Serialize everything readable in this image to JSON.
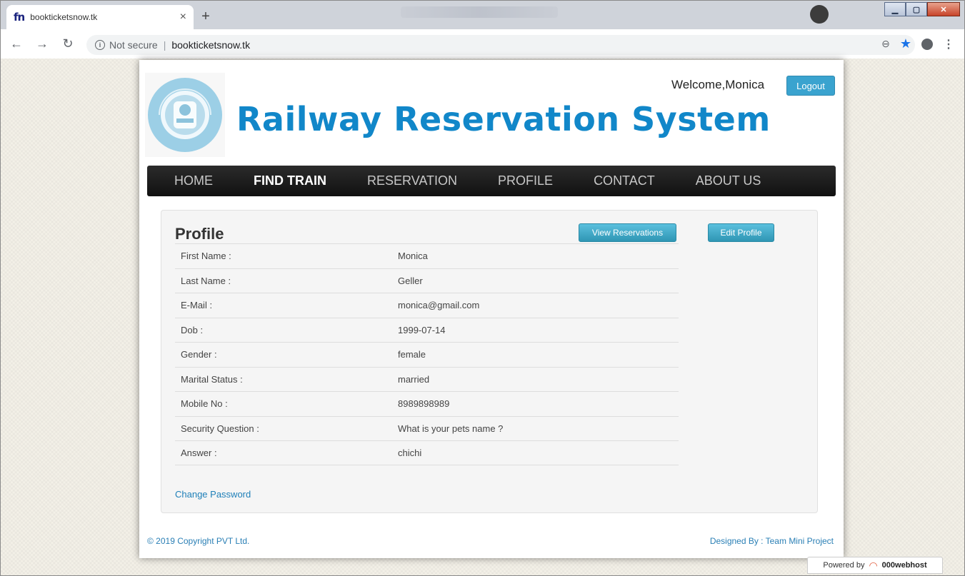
{
  "browser": {
    "tab_title": "bookticketsnow.tk",
    "favicon_text": "fn",
    "close_glyph": "×",
    "new_tab_glyph": "+",
    "not_secure_label": "Not secure",
    "url": "bookticketsnow.tk"
  },
  "header": {
    "site_title": "Railway Reservation System",
    "welcome_text": "Welcome,Monica",
    "logout_label": "Logout",
    "logo_text": "INDIAN RAILWAYS",
    "brand_color": "#1187c9"
  },
  "nav": {
    "items": [
      {
        "label": "HOME",
        "active": false
      },
      {
        "label": "FIND TRAIN",
        "active": true
      },
      {
        "label": "RESERVATION",
        "active": false
      },
      {
        "label": "PROFILE",
        "active": false
      },
      {
        "label": "CONTACT",
        "active": false
      },
      {
        "label": "ABOUT US",
        "active": false
      }
    ]
  },
  "profile": {
    "title": "Profile",
    "view_reservations_label": "View Reservations",
    "edit_profile_label": "Edit Profile",
    "change_password_label": "Change Password",
    "fields": [
      {
        "label": "First Name :",
        "value": "Monica"
      },
      {
        "label": "Last Name :",
        "value": "Geller"
      },
      {
        "label": "E-Mail :",
        "value": "monica@gmail.com"
      },
      {
        "label": "Dob :",
        "value": "1999-07-14"
      },
      {
        "label": "Gender :",
        "value": "female"
      },
      {
        "label": "Marital Status :",
        "value": "married"
      },
      {
        "label": "Mobile No :",
        "value": "8989898989"
      },
      {
        "label": "Security Question :",
        "value": "What is your pets name ?"
      },
      {
        "label": "Answer :",
        "value": "chichi"
      }
    ]
  },
  "footer": {
    "copyright": "© 2019 Copyright PVT Ltd.",
    "designed_by": "Designed By : Team Mini Project",
    "powered_by": "Powered by",
    "host_brand": "000webhost"
  }
}
